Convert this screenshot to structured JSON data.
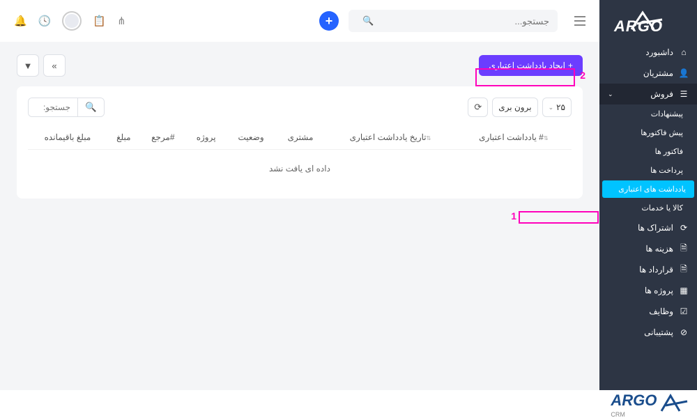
{
  "logo_text": "ARGO",
  "search": {
    "placeholder": "جستجو..."
  },
  "sidebar": {
    "items": [
      {
        "label": "داشبورد",
        "icon": "home"
      },
      {
        "label": "مشتریان",
        "icon": "user"
      },
      {
        "label": "فروش",
        "icon": "list",
        "expanded": true,
        "children": [
          {
            "label": "پیشنهادات"
          },
          {
            "label": "پیش فاکتورها"
          },
          {
            "label": "فاکتور ها"
          },
          {
            "label": "پرداخت ها"
          },
          {
            "label": "یادداشت های اعتباری",
            "active": true
          },
          {
            "label": "کالا یا خدمات"
          }
        ]
      },
      {
        "label": "اشتراک ها",
        "icon": "refresh"
      },
      {
        "label": "هزینه ها",
        "icon": "file"
      },
      {
        "label": "قرارداد ها",
        "icon": "file"
      },
      {
        "label": "پروژه ها",
        "icon": "grid"
      },
      {
        "label": "وظایف",
        "icon": "check"
      },
      {
        "label": "پشتیبانی",
        "icon": "support"
      }
    ]
  },
  "actions": {
    "create_label": "ایجاد یادداشت اعتباری"
  },
  "table_controls": {
    "page_size": "۲۵",
    "export_label": "برون بری",
    "search_placeholder": "جستجو:"
  },
  "table": {
    "columns": [
      "# یادداشت اعتباری",
      "تاریخ یادداشت اعتباری",
      "مشتری",
      "وضعیت",
      "پروژه",
      "#مرجع",
      "مبلغ",
      "مبلغ باقیمانده"
    ],
    "empty_message": "داده ای یافت نشد"
  },
  "annotations": {
    "a1": "1",
    "a2": "2"
  },
  "footer": {
    "main": "ARGO",
    "sub": "CRM"
  }
}
